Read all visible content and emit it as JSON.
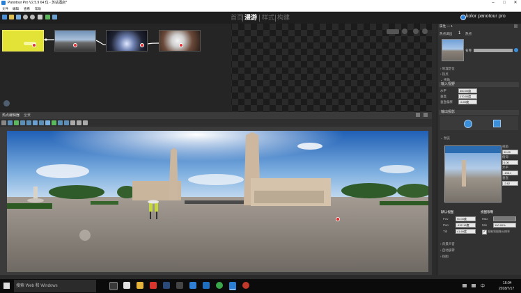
{
  "window": {
    "title": "Panotour Pro V2.5.9 64 位 - 苏站酒店*"
  },
  "menu": [
    "文件",
    "编辑",
    "查看",
    "帮助"
  ],
  "modes": [
    {
      "label": "首页",
      "active": false
    },
    {
      "label": "漫游",
      "active": true
    },
    {
      "label": "样式",
      "active": false
    },
    {
      "label": "构建",
      "active": false
    }
  ],
  "logo": {
    "text": "kolor panotour pro"
  },
  "tour_nodes": [
    {
      "num": "1",
      "selected": true
    },
    {
      "num": "2",
      "selected": false
    },
    {
      "num": "3",
      "selected": false
    },
    {
      "num": "4",
      "selected": false
    }
  ],
  "viewer": {
    "tab1": "热点编辑器",
    "tab2": "全景"
  },
  "right_panel": {
    "header": "属性 — 1",
    "hotspot_count_label": "热点调出",
    "hotspot_count": "1",
    "hotspot_suffix": "热点",
    "name_label": "名称",
    "sections_collapsed": [
      "地理定位",
      "热点",
      "视角"
    ],
    "input_view_title": "输入视野",
    "input_view_rows": [
      {
        "label": "水平",
        "value": "360.00度"
      },
      {
        "label": "垂直",
        "value": "170.00度"
      },
      {
        "label": "垂直偏移",
        "value": "-5.00度"
      }
    ],
    "output_projection_title": "输出投影",
    "preview_section": "预览",
    "preview_fields": [
      {
        "label": "视角",
        "value": "90.00"
      },
      {
        "label": "俯仰",
        "value": "0.00"
      },
      {
        "label": "水平",
        "value": "-136.1"
      },
      {
        "label": "垂直",
        "value": "-2.62"
      }
    ],
    "default_view_title": "默认视图",
    "default_view_rows": [
      {
        "label": "Fov",
        "value": "90.00度"
      },
      {
        "label": "Pan",
        "value": "-132.18度"
      },
      {
        "label": "Tilt",
        "value": "41.69度"
      }
    ],
    "limits_title": "视图限制",
    "limits_rows": [
      {
        "label": "Max",
        "value": ""
      },
      {
        "label": "Min",
        "value": "100.00%"
      }
    ],
    "limits_check": "限制到图像分辨率",
    "bottom_sections": [
      "背景声音",
      "自动旋转",
      "热图"
    ]
  },
  "taskbar": {
    "search_placeholder": "搜索 Web 和 Windows",
    "time": "16:04",
    "date": "2018/7/17",
    "lang": "中"
  }
}
